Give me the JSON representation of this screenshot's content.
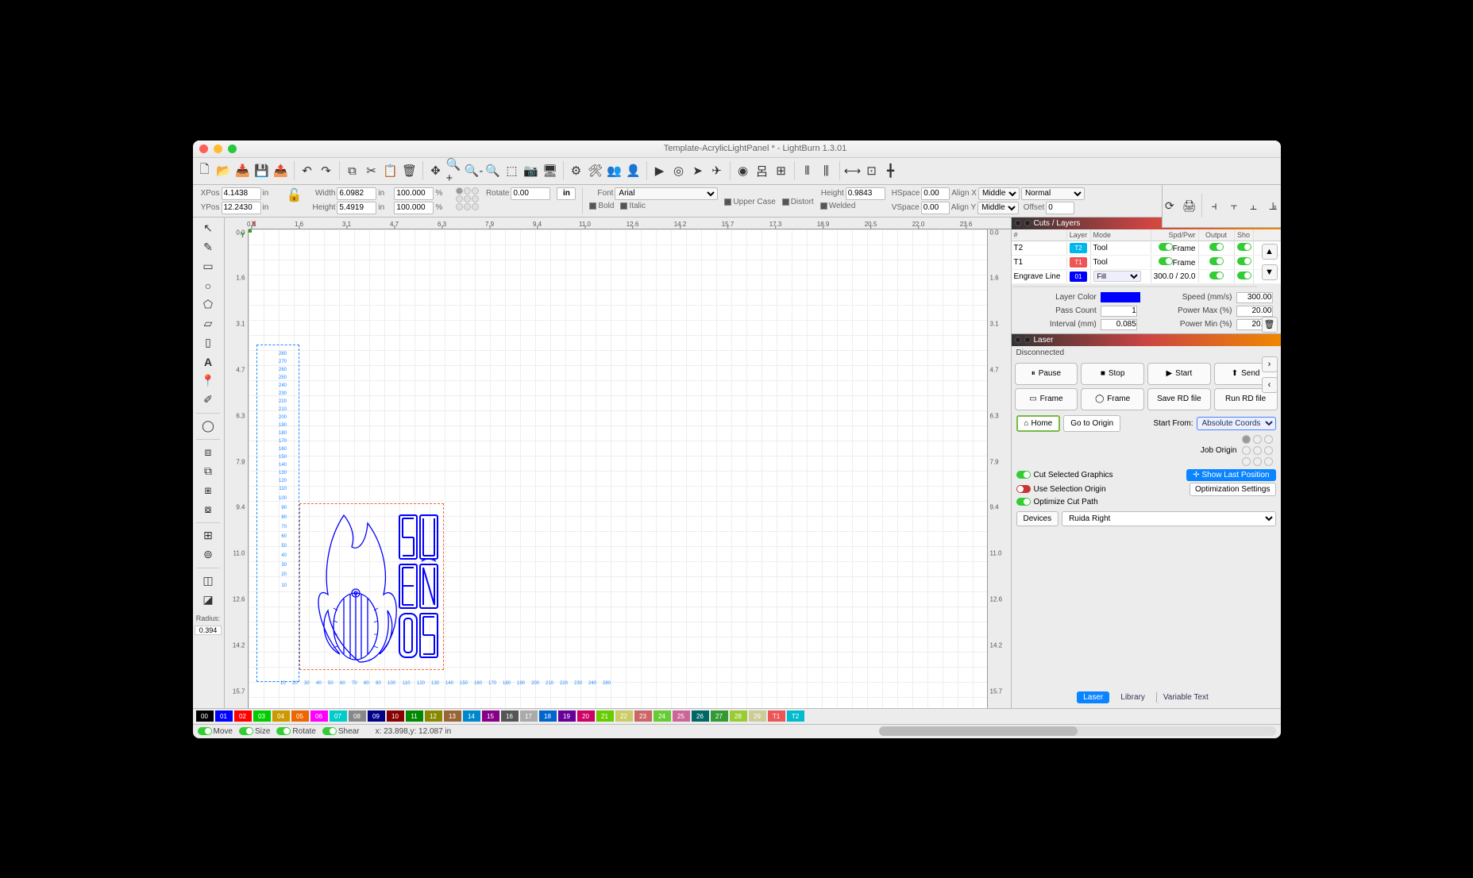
{
  "window": {
    "title": "Template-AcrylicLightPanel * - LightBurn 1.3.01"
  },
  "props": {
    "xpos_label": "XPos",
    "xpos": "4.1438",
    "xpos_unit": "in",
    "ypos_label": "YPos",
    "ypos": "12.2430",
    "ypos_unit": "in",
    "width_label": "Width",
    "width": "6.0982",
    "width_unit": "in",
    "width_pct": "100.000",
    "pct": "%",
    "height_label": "Height",
    "height": "5.4919",
    "height_unit": "in",
    "height_pct": "100.000",
    "rotate_label": "Rotate",
    "rotate": "0.00",
    "unit_btn": "in",
    "font_label": "Font",
    "font": "Arial",
    "bold": "Bold",
    "italic": "Italic",
    "upper": "Upper Case",
    "distort": "Distort",
    "hgt_label": "Height",
    "hgt": "0.9843",
    "welded": "Welded",
    "hspace_label": "HSpace",
    "hspace": "0.00",
    "vspace_label": "VSpace",
    "vspace": "0.00",
    "alignx_label": "Align X",
    "alignx": "Middle",
    "aligny_label": "Align Y",
    "aligny": "Middle",
    "normal": "Normal",
    "offset_label": "Offset",
    "offset": "0"
  },
  "left_tools": {
    "radius_label": "Radius:",
    "radius": "0.394"
  },
  "rulers": {
    "h": [
      "0.0",
      "1.6",
      "3.1",
      "4.7",
      "6.3",
      "7.9",
      "9.4",
      "11.0",
      "12.6",
      "14.2",
      "15.7",
      "17.3",
      "18.9",
      "20.5",
      "22.0",
      "23.6"
    ],
    "v": [
      "0.0",
      "1.6",
      "3.1",
      "4.7",
      "6.3",
      "7.9",
      "9.4",
      "11.0",
      "12.6",
      "14.2",
      "15.7"
    ],
    "v_right": [
      "0.0",
      "1.6",
      "3.1",
      "4.7",
      "6.3",
      "7.9",
      "9.4",
      "11.0",
      "12.6",
      "14.2",
      "15.7"
    ]
  },
  "cuts_layers": {
    "title": "Cuts / Layers",
    "head": {
      "num": "#",
      "layer": "Layer",
      "mode": "Mode",
      "sp": "Spd/Pwr",
      "output": "Output",
      "show": "Sho"
    },
    "rows": [
      {
        "name": "T2",
        "chip": "T2",
        "chip_color": "#00b7eb",
        "mode": "Tool",
        "sp": "",
        "frame": "Frame"
      },
      {
        "name": "T1",
        "chip": "T1",
        "chip_color": "#e55",
        "mode": "Tool",
        "sp": "",
        "frame": "Frame"
      },
      {
        "name": "Engrave Line",
        "chip": "01",
        "chip_color": "#00f",
        "mode": "Fill",
        "sp": "300.0 / 20.0",
        "frame": ""
      }
    ],
    "layer_color_label": "Layer Color",
    "speed_label": "Speed (mm/s)",
    "speed": "300.00",
    "pass_label": "Pass Count",
    "pass": "1",
    "pmax_label": "Power Max (%)",
    "pmax": "20.00",
    "interval_label": "Interval (mm)",
    "interval": "0.085",
    "pmin_label": "Power Min (%)",
    "pmin": "20.00"
  },
  "laser": {
    "title": "Laser",
    "status": "Disconnected",
    "pause": "Pause",
    "stop": "Stop",
    "start": "Start",
    "send": "Send",
    "frame1": "Frame",
    "frame2": "Frame",
    "save_rd": "Save RD file",
    "run_rd": "Run RD file",
    "home": "Home",
    "goto_origin": "Go to Origin",
    "start_from_label": "Start From:",
    "start_from": "Absolute Coords",
    "job_origin_label": "Job Origin",
    "cut_selected": "Cut Selected Graphics",
    "use_sel_origin": "Use Selection Origin",
    "optimize": "Optimize Cut Path",
    "show_last": "Show Last Position",
    "opt_settings": "Optimization Settings",
    "devices": "Devices",
    "device_sel": "Ruida Right",
    "tab_laser": "Laser",
    "tab_library": "Library",
    "tab_vartext": "Variable Text"
  },
  "palette": [
    {
      "n": "00",
      "c": "#000"
    },
    {
      "n": "01",
      "c": "#00f"
    },
    {
      "n": "02",
      "c": "#f00"
    },
    {
      "n": "03",
      "c": "#0c0"
    },
    {
      "n": "04",
      "c": "#c90"
    },
    {
      "n": "05",
      "c": "#e60"
    },
    {
      "n": "06",
      "c": "#f0f"
    },
    {
      "n": "07",
      "c": "#0cc"
    },
    {
      "n": "08",
      "c": "#888"
    },
    {
      "n": "09",
      "c": "#008"
    },
    {
      "n": "10",
      "c": "#800"
    },
    {
      "n": "11",
      "c": "#080"
    },
    {
      "n": "12",
      "c": "#880"
    },
    {
      "n": "13",
      "c": "#963"
    },
    {
      "n": "14",
      "c": "#08c"
    },
    {
      "n": "15",
      "c": "#808"
    },
    {
      "n": "16",
      "c": "#555"
    },
    {
      "n": "17",
      "c": "#aaa"
    },
    {
      "n": "18",
      "c": "#06c"
    },
    {
      "n": "19",
      "c": "#609"
    },
    {
      "n": "20",
      "c": "#c06"
    },
    {
      "n": "21",
      "c": "#6c0"
    },
    {
      "n": "22",
      "c": "#cc6"
    },
    {
      "n": "23",
      "c": "#c66"
    },
    {
      "n": "24",
      "c": "#6c3"
    },
    {
      "n": "25",
      "c": "#c69"
    },
    {
      "n": "26",
      "c": "#066"
    },
    {
      "n": "27",
      "c": "#393"
    },
    {
      "n": "28",
      "c": "#9c3"
    },
    {
      "n": "29",
      "c": "#cc9"
    }
  ],
  "palette_extra": [
    {
      "n": "T1",
      "c": "#e55"
    },
    {
      "n": "T2",
      "c": "#0bc"
    }
  ],
  "status": {
    "move": "Move",
    "size": "Size",
    "rotate": "Rotate",
    "shear": "Shear",
    "coords": "x: 23.898,y: 12.087 in"
  }
}
